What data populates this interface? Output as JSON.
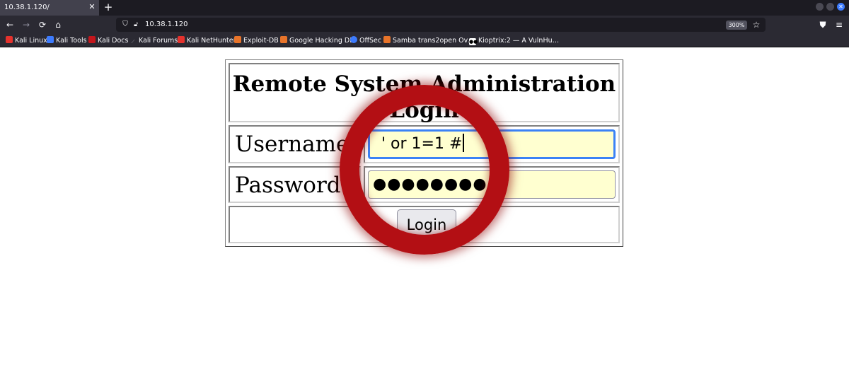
{
  "browser": {
    "tab_title": "10.38.1.120/",
    "tab_close": "✕",
    "new_tab": "+",
    "url": "10.38.1.120",
    "zoom": "300%",
    "bookmarks": [
      {
        "label": "Kali Linux",
        "color": "#e5322d"
      },
      {
        "label": "Kali Tools",
        "color": "#3d7bfd"
      },
      {
        "label": "Kali Docs",
        "color": "#c4161c"
      },
      {
        "label": "Kali Forums",
        "color": "#8f8f9d"
      },
      {
        "label": "Kali NetHunter",
        "color": "#e5322d"
      },
      {
        "label": "Exploit-DB",
        "color": "#e8742a"
      },
      {
        "label": "Google Hacking DB",
        "color": "#e8742a"
      },
      {
        "label": "OffSec",
        "color": "#3d7bfd"
      },
      {
        "label": "Samba trans2open Ov…",
        "color": "#e8742a"
      },
      {
        "label": "Kioptrix:2 — A VulnHu…",
        "color": "#ffffff"
      }
    ]
  },
  "page": {
    "title": "Remote System Administration Login",
    "username_label": "Username",
    "username_value": "' or 1=1 #",
    "password_label": "Password",
    "password_value": "●●●●●●●●",
    "login_button": "Login"
  },
  "colors": {
    "highlight_ring": "#b30f14",
    "input_background": "#ffffd0",
    "focus_border": "#3b82f6"
  }
}
